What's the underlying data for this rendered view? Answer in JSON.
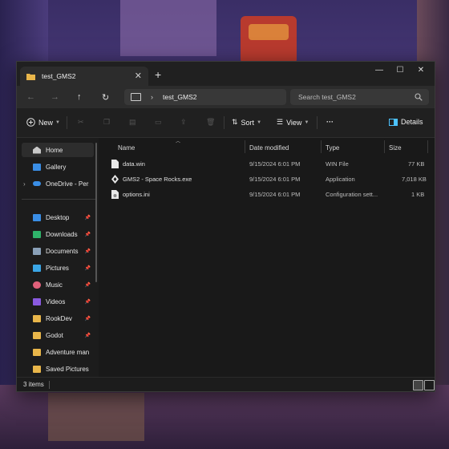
{
  "window": {
    "tab_title": "test_GMS2",
    "new_tab": "+",
    "close_tab": "✕"
  },
  "window_controls": {
    "minimize": "—",
    "maximize": "☐",
    "close": "✕"
  },
  "nav": {
    "back": "←",
    "forward": "→",
    "up": "↑",
    "refresh": "↻"
  },
  "address": {
    "path": "test_GMS2",
    "chevron": "›"
  },
  "search": {
    "placeholder": "Search test_GMS2"
  },
  "toolbar": {
    "new_label": "New",
    "sort_label": "Sort",
    "view_label": "View",
    "more_label": "···",
    "details_label": "Details"
  },
  "sidebar": {
    "items": [
      {
        "label": "Home",
        "icon": "home-icon",
        "pinned": false,
        "selected": true
      },
      {
        "label": "Gallery",
        "icon": "gallery-icon",
        "pinned": false
      },
      {
        "label": "OneDrive - Perso",
        "icon": "onedrive-icon",
        "pinned": false,
        "expandable": true
      },
      {
        "label": "Desktop",
        "icon": "desktop-icon",
        "pinned": true
      },
      {
        "label": "Downloads",
        "icon": "downloads-icon",
        "pinned": true
      },
      {
        "label": "Documents",
        "icon": "documents-icon",
        "pinned": true
      },
      {
        "label": "Pictures",
        "icon": "pictures-icon",
        "pinned": true
      },
      {
        "label": "Music",
        "icon": "music-icon",
        "pinned": true
      },
      {
        "label": "Videos",
        "icon": "videos-icon",
        "pinned": true
      },
      {
        "label": "RookDev",
        "icon": "folder-icon",
        "pinned": true
      },
      {
        "label": "Godot",
        "icon": "folder-icon",
        "pinned": true
      },
      {
        "label": "Adventure manu",
        "icon": "folder-icon",
        "pinned": false
      },
      {
        "label": "Saved Pictures",
        "icon": "folder-icon",
        "pinned": false
      }
    ],
    "pin_glyph": "📌",
    "expand_glyph": "›"
  },
  "columns": {
    "name": "Name",
    "date": "Date modified",
    "type": "Type",
    "size": "Size"
  },
  "files": [
    {
      "name": "data.win",
      "date": "9/15/2024 6:01 PM",
      "type": "WIN File",
      "size": "77 KB",
      "icon": "file-icon"
    },
    {
      "name": "GMS2 - Space Rocks.exe",
      "date": "9/15/2024 6:01 PM",
      "type": "Application",
      "size": "7,018 KB",
      "icon": "app-icon"
    },
    {
      "name": "options.ini",
      "date": "9/15/2024 6:01 PM",
      "type": "Configuration sett...",
      "size": "1 KB",
      "icon": "config-icon"
    }
  ],
  "status": {
    "count": "3 items"
  },
  "colors": {
    "accent": "#4cc2ff",
    "folder": "#e9b64a",
    "window_bg": "#1c1c1c"
  }
}
